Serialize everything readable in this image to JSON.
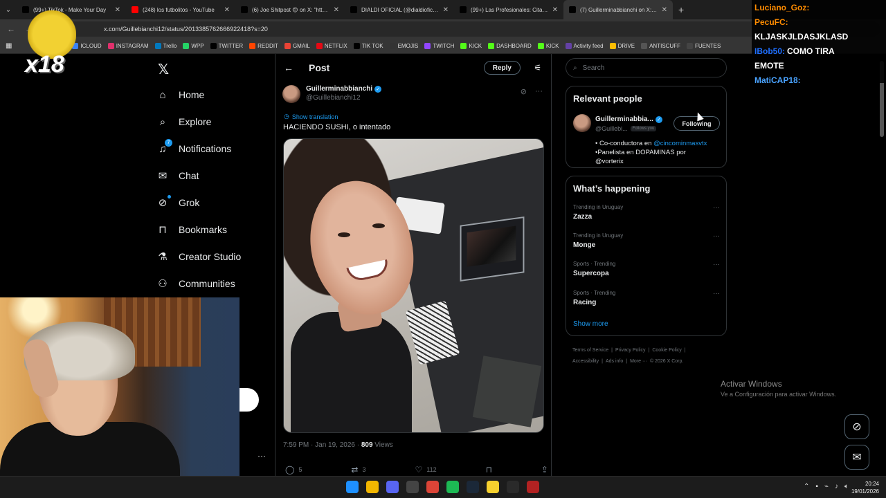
{
  "browser": {
    "tabs": [
      {
        "title": "(99+) TikTok - Make Your Day",
        "icon": "tiktok-icon",
        "color": "#000000"
      },
      {
        "title": "(248) los futbolitos - YouTube",
        "icon": "youtube-icon",
        "color": "#ff0000"
      },
      {
        "title": "(6) Joe Shitpost 😊 on X: \"http...",
        "icon": "x-icon",
        "color": "#000000"
      },
      {
        "title": "DIALDI OFICIAL (@dialdioficial)",
        "icon": "tiktok-icon",
        "color": "#000000"
      },
      {
        "title": "(99+) Las Profesionales: Cita De...",
        "icon": "tiktok-icon",
        "color": "#000000"
      },
      {
        "title": "(7) Guillerminabbianchi on X: \"H...",
        "icon": "x-icon",
        "color": "#000000",
        "active": true
      }
    ],
    "url": "x.com/Guillebianchi12/status/2013385762666922418?s=20",
    "bookmarks": [
      {
        "label": "ICLOUD",
        "color": "#3b82f6"
      },
      {
        "label": "INSTAGRAM",
        "color": "#e1306c"
      },
      {
        "label": "Trello",
        "color": "#0079bf"
      },
      {
        "label": "WPP",
        "color": "#25d366"
      },
      {
        "label": "TWITTER",
        "color": "#000000"
      },
      {
        "label": "REDDIT",
        "color": "#ff4500"
      },
      {
        "label": "GMAIL",
        "color": "#ea4335"
      },
      {
        "label": "NETFLIX",
        "color": "#e50914"
      },
      {
        "label": "TIK TOK",
        "color": "#000000"
      },
      {
        "label": "EMOJIS",
        "color": "#333333"
      },
      {
        "label": "TWITCH",
        "color": "#9146ff"
      },
      {
        "label": "KICK",
        "color": "#53fc18"
      },
      {
        "label": "DASHBOARD",
        "color": "#53fc18"
      },
      {
        "label": "KICK",
        "color": "#53fc18"
      },
      {
        "label": "Activity feed",
        "color": "#6441a5"
      },
      {
        "label": "DRIVE",
        "color": "#fbbc04"
      },
      {
        "label": "ANTISCUFF",
        "color": "#555555"
      },
      {
        "label": "FUENTES",
        "color": "#444444"
      }
    ]
  },
  "nav": {
    "items": [
      {
        "label": "Home",
        "icon": "home-icon"
      },
      {
        "label": "Explore",
        "icon": "search-icon"
      },
      {
        "label": "Notifications",
        "icon": "bell-icon",
        "badge": "7"
      },
      {
        "label": "Chat",
        "icon": "mail-icon"
      },
      {
        "label": "Grok",
        "icon": "grok-icon"
      },
      {
        "label": "Bookmarks",
        "icon": "bookmark-icon"
      },
      {
        "label": "Creator Studio",
        "icon": "flask-icon"
      },
      {
        "label": "Communities",
        "icon": "people-icon"
      }
    ]
  },
  "post": {
    "header_title": "Post",
    "reply_label": "Reply",
    "author_name": "Guillerminabbianchi",
    "author_handle": "@Guillebianchi12",
    "show_translation": "Show translation",
    "text": "HACIENDO SUSHI, o intentado",
    "time": "7:59 PM · Jan 19, 2026 · ",
    "views": "809",
    "views_label": " Views",
    "replies": "5",
    "reposts": "3",
    "likes": "112"
  },
  "search": {
    "placeholder": "Search"
  },
  "relevant": {
    "title": "Relevant people",
    "name": "Guillerminabbia...",
    "handle": "@Guillebi...",
    "follows_you": "Follows you",
    "following_label": "Following",
    "bio_line1_prefix": "• Co-conductora en ",
    "bio_line1_link": "@cincominmasvtx",
    "bio_line2": "•Panelista en DOPAMINAS por",
    "bio_line3_link": "@vorterix"
  },
  "happening": {
    "title": "What’s happening",
    "trends": [
      {
        "context": "Trending in Uruguay",
        "topic": "Zazza"
      },
      {
        "context": "Trending in Uruguay",
        "topic": "Monge"
      },
      {
        "context": "Sports · Trending",
        "topic": "Supercopa"
      },
      {
        "context": "Sports · Trending",
        "topic": "Racing"
      }
    ],
    "show_more": "Show more"
  },
  "footer": {
    "line1": [
      "Terms of Service",
      "|",
      "Privacy Policy",
      "|",
      "Cookie Policy",
      "|"
    ],
    "line2": [
      "Accessibility",
      "|",
      "Ads info",
      "|",
      "More ···",
      "© 2026 X Corp."
    ]
  },
  "windows": {
    "activate_title": "Activar Windows",
    "activate_sub": "Ve a Configuración para activar Windows.",
    "time": "20:24",
    "date": "19/01/2026"
  },
  "overlay": {
    "x18": "x18",
    "chat": [
      {
        "user": "Luciano_Goz:",
        "msg": "",
        "color": "#ff8c00"
      },
      {
        "user": "PecuFC:",
        "msg": "",
        "color": "#ff8c00"
      },
      {
        "user": "",
        "msg": "KLJASKJLDASJKLASD",
        "color": "#ffffff"
      },
      {
        "user": "IBob50:",
        "msg": "COMO TIRA",
        "color": "#1e6fff"
      },
      {
        "user": "",
        "msg": "EMOTE",
        "color": "#ffffff"
      },
      {
        "user": "MatiCAP18:",
        "msg": "",
        "color": "#4aa3ff"
      }
    ]
  },
  "taskbar": {
    "apps": [
      {
        "icon": "windows-icon",
        "color": "#1e90ff"
      },
      {
        "icon": "explorer-icon",
        "color": "#f2b600"
      },
      {
        "icon": "discord-icon",
        "color": "#5865f2"
      },
      {
        "icon": "obs-icon",
        "color": "#444444"
      },
      {
        "icon": "chrome-icon",
        "color": "#db4437"
      },
      {
        "icon": "spotify-icon",
        "color": "#1db954"
      },
      {
        "icon": "steam-icon",
        "color": "#1b2838"
      },
      {
        "icon": "notes-icon",
        "color": "#f7d12e"
      },
      {
        "icon": "epic-icon",
        "color": "#2a2a2a"
      },
      {
        "icon": "voicemeeter-icon",
        "color": "#b22222"
      }
    ]
  }
}
